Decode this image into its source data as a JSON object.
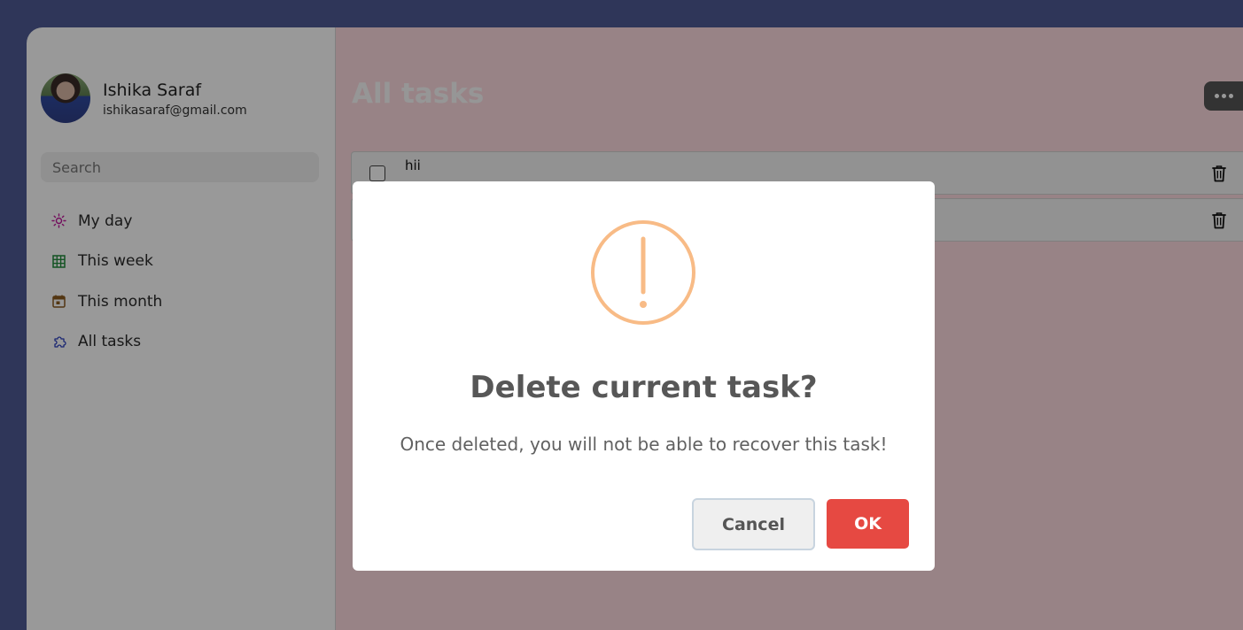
{
  "profile": {
    "name": "Ishika Saraf",
    "email": "ishikasaraf@gmail.com"
  },
  "search": {
    "placeholder": "Search",
    "value": ""
  },
  "sidebar": {
    "items": [
      {
        "label": "My day",
        "icon": "sun-icon",
        "color": "#c0169c"
      },
      {
        "label": "This week",
        "icon": "grid-calendar-icon",
        "color": "#1f8a3a"
      },
      {
        "label": "This month",
        "icon": "calendar-icon",
        "color": "#8a5a1f"
      },
      {
        "label": "All tasks",
        "icon": "puzzle-icon",
        "color": "#2b3fbf"
      }
    ]
  },
  "main": {
    "title": "All tasks",
    "more_icon": "more-dots-icon",
    "tasks": [
      {
        "title": "hii",
        "date": "",
        "trash_icon": "trash-icon"
      },
      {
        "title": "",
        "date": "",
        "trash_icon": "trash-icon"
      }
    ]
  },
  "dialog": {
    "icon": "warning-icon",
    "icon_color": "#f8bb86",
    "title": "Delete current task?",
    "text": "Once deleted, you will not be able to recover this task!",
    "cancel_label": "Cancel",
    "ok_label": "OK",
    "ok_color": "#e64942"
  }
}
